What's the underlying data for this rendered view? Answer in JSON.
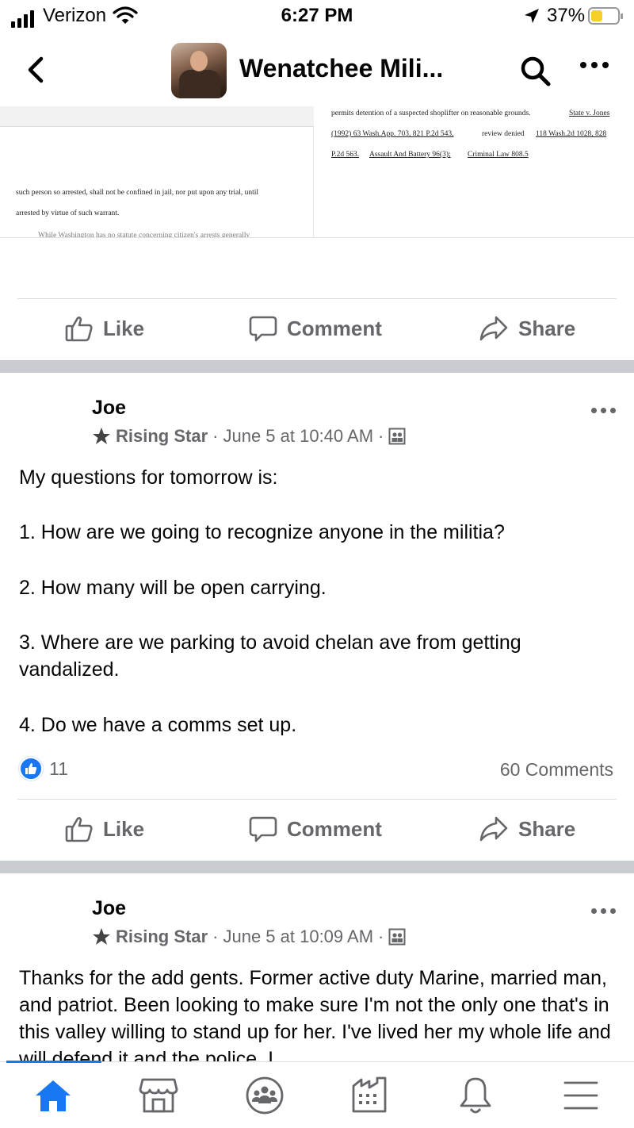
{
  "status_bar": {
    "carrier": "Verizon",
    "time": "6:27 PM",
    "battery_percent": "37%",
    "battery_level": 0.37,
    "icons": [
      "signal-icon",
      "wifi-icon",
      "location-arrow-icon",
      "battery-icon"
    ]
  },
  "header": {
    "title": "Wenatchee Mili...",
    "icons": [
      "back-chevron-icon",
      "search-icon",
      "more-icon"
    ]
  },
  "document_excerpt": {
    "right_lines": [
      "permits detention of a suspected shoplifter on reasonable grounds.",
      "State v. Jones",
      "(1992) 63 Wash.App. 703, 821 P.2d 543,",
      "review denied",
      "118 Wash.2d 1028, 828",
      "P.2d 563.",
      "Assault And Battery 96(3);",
      "Criminal Law 808.5"
    ],
    "left_lines": [
      "such person so arrested, shall not be confined in jail, nor put upon any trial, until",
      "arrested by virtue of such warrant.",
      "While Washington has no statute concerning citizen's arrests generally"
    ]
  },
  "actions": {
    "like": "Like",
    "comment": "Comment",
    "share": "Share"
  },
  "posts": [
    {
      "author": "Joe",
      "badge": "Rising Star",
      "separator": "·",
      "timestamp": "June 5 at 10:40 AM",
      "lines": [
        "My questions for tomorrow is:",
        "1. How are we going to recognize anyone in the militia?",
        "2. How many will be open carrying.",
        "3. Where are we parking to avoid chelan ave from getting vandalized.",
        "4. Do we have a comms set up."
      ],
      "reaction_count": "11",
      "comments_label": "60 Comments"
    },
    {
      "author": "Joe",
      "badge": "Rising Star",
      "separator": "·",
      "timestamp": "June 5 at 10:09 AM",
      "text": "Thanks for the add gents. Former active duty Marine, married man, and patriot. Been looking to make sure I'm not the only one that's in this valley willing to stand up for her. I've lived her my whole life and will defend it and the police. I"
    }
  ],
  "bottom_nav": {
    "items": [
      "home-icon",
      "marketplace-icon",
      "groups-icon",
      "pages-icon",
      "notifications-icon",
      "menu-icon"
    ],
    "active": "home-icon",
    "accent_color": "#1877f2"
  }
}
